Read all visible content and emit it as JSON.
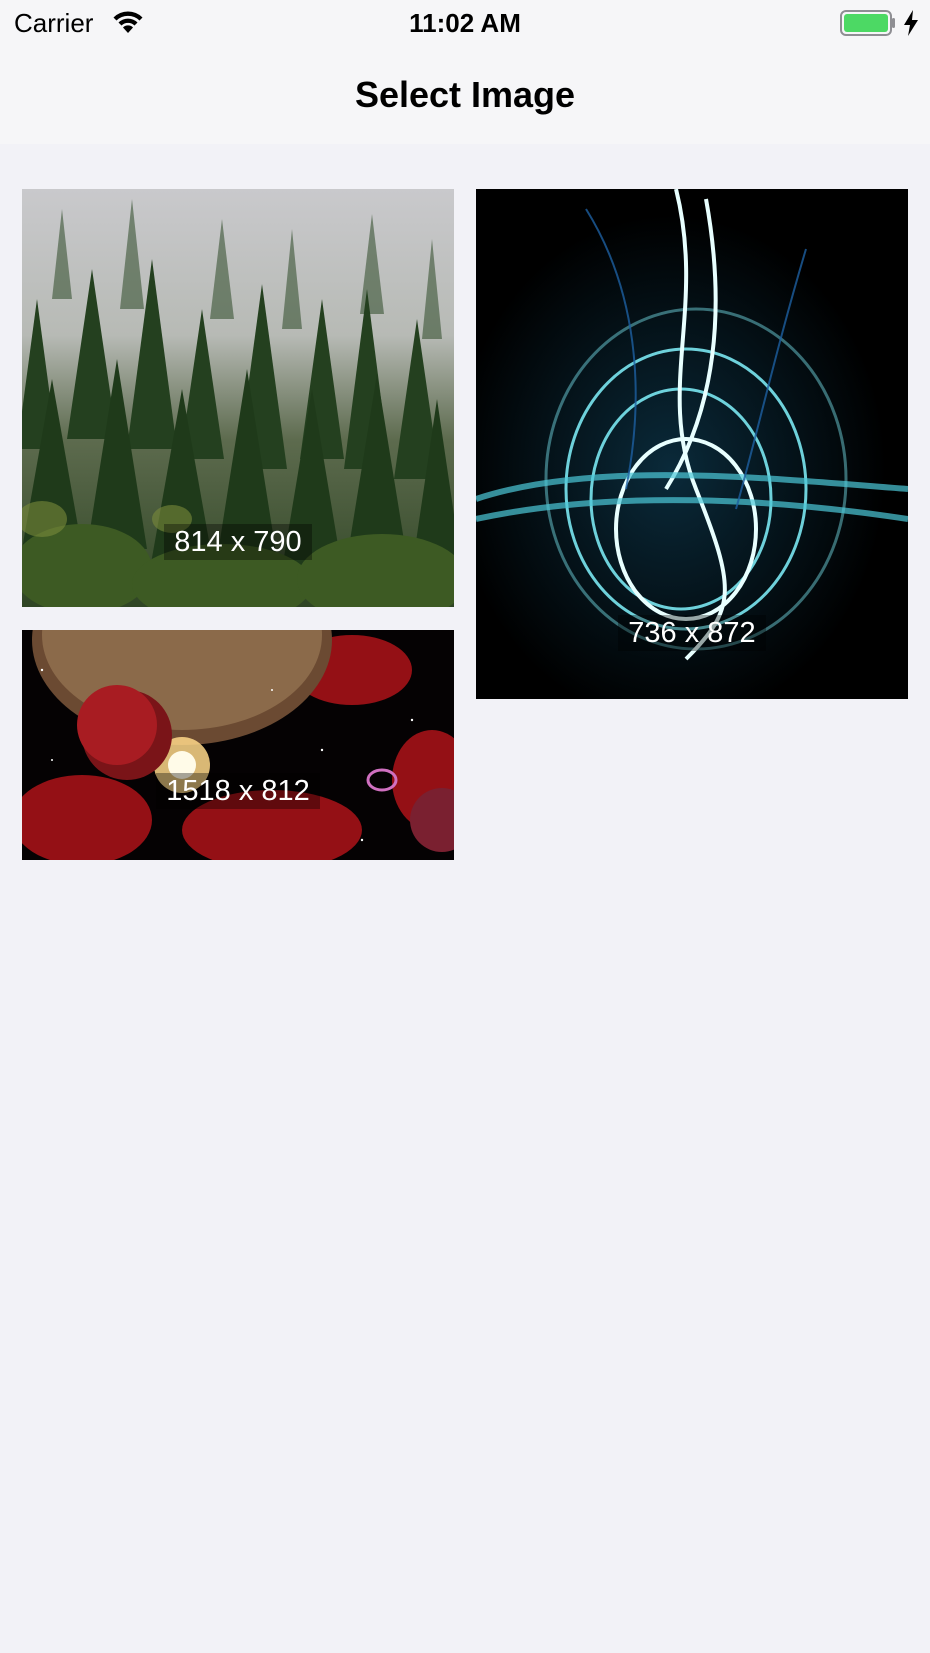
{
  "status_bar": {
    "carrier": "Carrier",
    "time": "11:02 AM",
    "icons": [
      "wifi-icon",
      "battery-icon",
      "charging-bolt-icon"
    ],
    "battery_color": "#4cd964"
  },
  "nav": {
    "title": "Select Image"
  },
  "images": [
    {
      "label": "814 x 790",
      "description_icon": "forest-photo"
    },
    {
      "label": "736 x 872",
      "description_icon": "energy-swirl-photo"
    },
    {
      "label": "1518 x 812",
      "description_icon": "space-planets-photo"
    }
  ],
  "colors": {
    "background": "#f2f2f7",
    "bar_background": "#f6f6f8"
  }
}
